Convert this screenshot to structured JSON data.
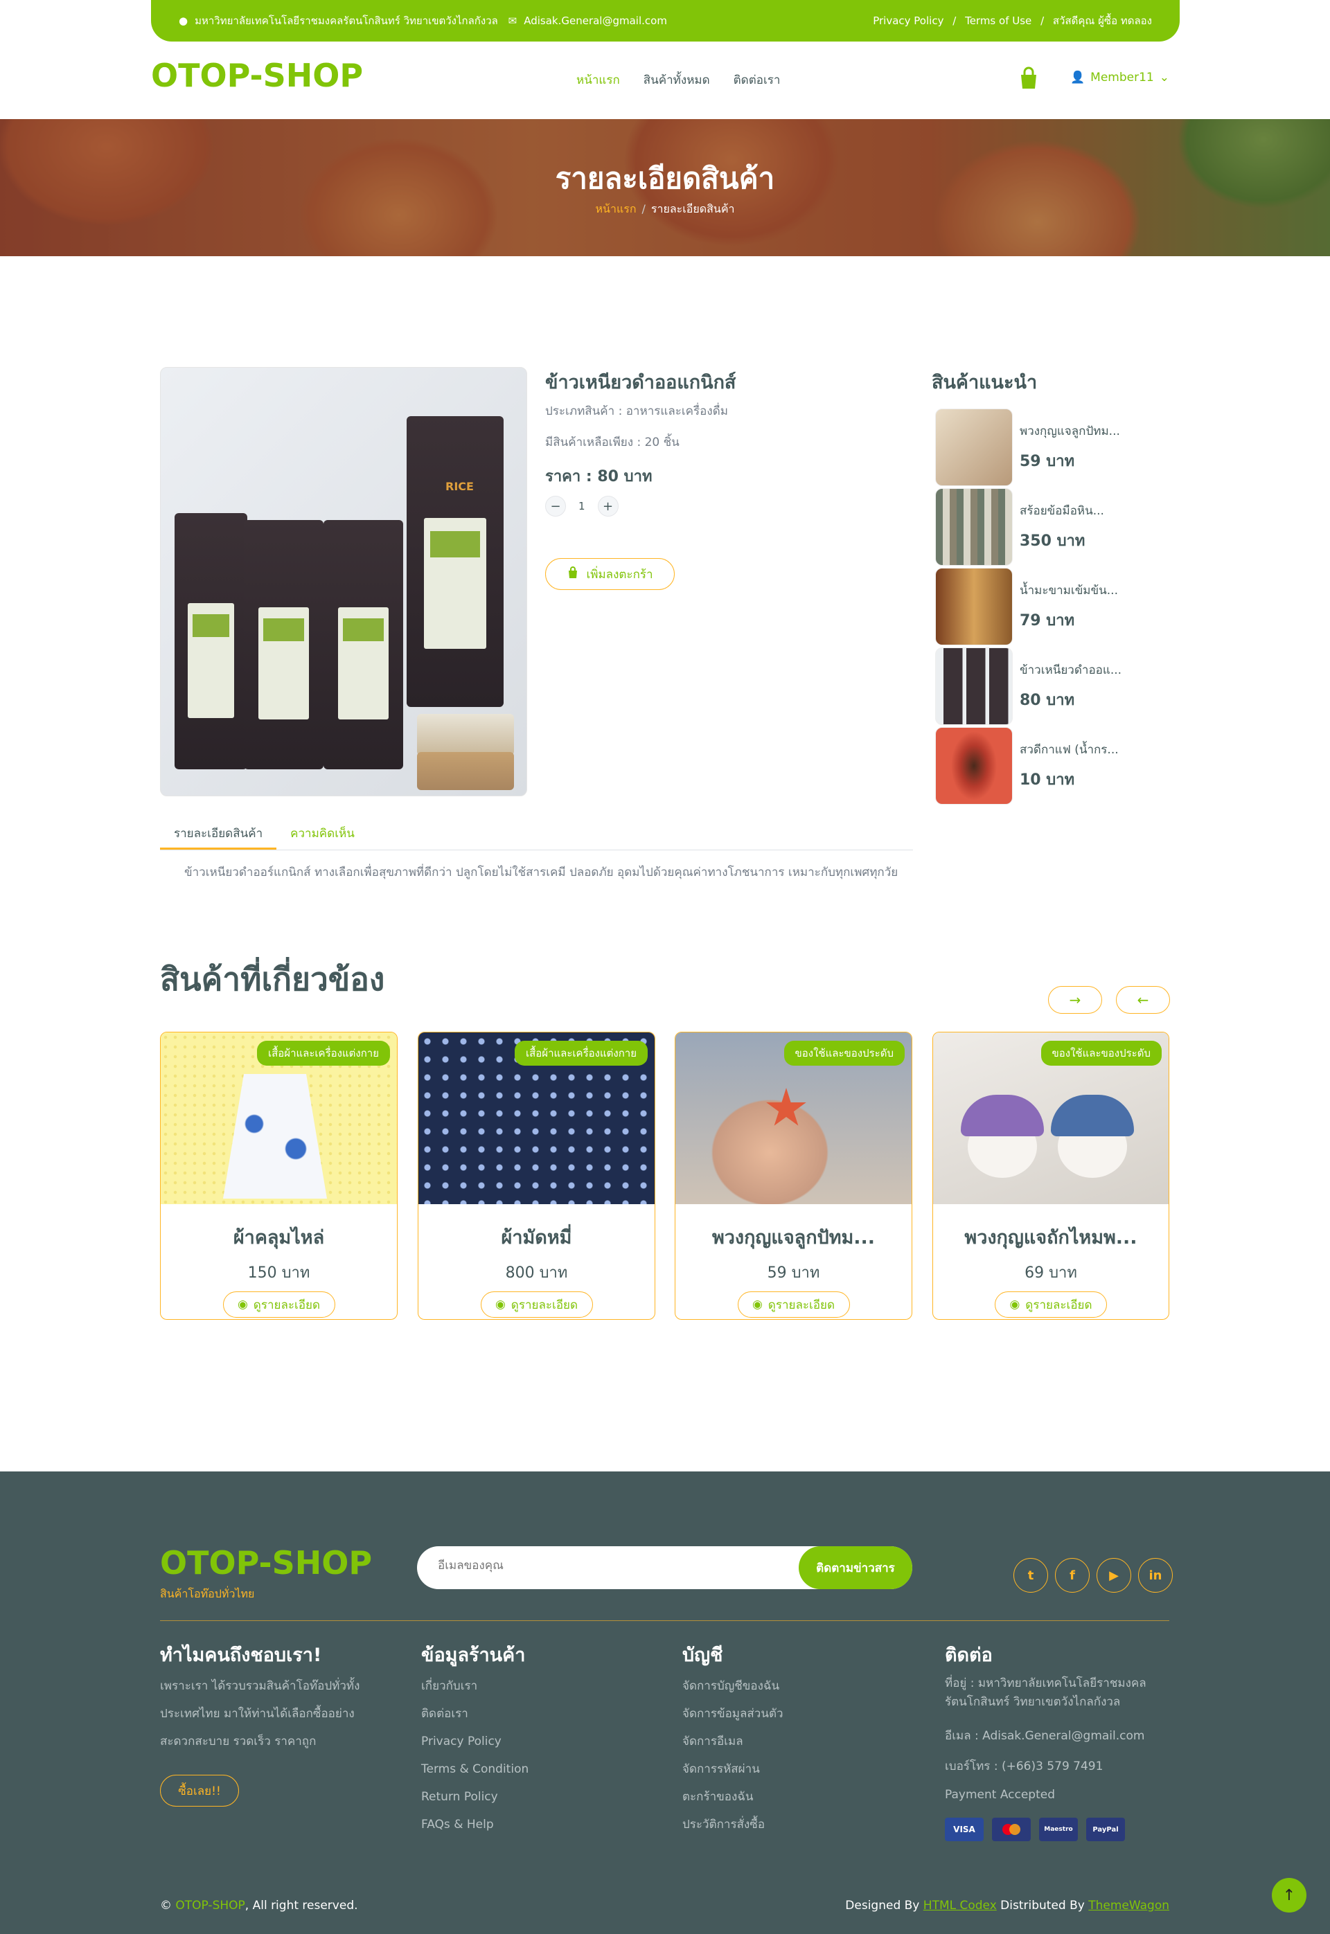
{
  "topbar": {
    "address": "มหาวิทยาลัยเทคโนโลยีราชมงคลรัตนโกสินทร์ วิทยาเขตวังไกลกังวล",
    "email": "Adisak.General@gmail.com",
    "links": [
      "Privacy Policy",
      "/",
      "Terms of Use",
      "/",
      "สวัสดีคุณ ผู้ซื้อ ทดลอง"
    ]
  },
  "nav": {
    "logo": "OTOP-SHOP",
    "items": [
      "หน้าแรก",
      "สินค้าทั้งหมด",
      "ติดต่อเรา"
    ],
    "member": "Member11"
  },
  "hero": {
    "title": "รายละเอียดสินค้า",
    "breadcrumb_home": "หน้าแรก",
    "breadcrumb_sep": "/",
    "breadcrumb_current": "รายละเอียดสินค้า"
  },
  "product": {
    "name": "ข้าวเหนียวดำออแกนิกส์",
    "category": "ประเภทสินค้า : อาหารและเครื่องดื่ม",
    "stock": "มีสินค้าเหลือเพียง : 20 ชิ้น",
    "price": "ราคา : 80 บาท",
    "qty_minus": "−",
    "qty": "1",
    "qty_plus": "+",
    "add_to_cart": "เพิ่มลงตะกร้า",
    "image_text": "RICE"
  },
  "tabs": {
    "detail": "รายละเอียดสินค้า",
    "reviews": "ความคิดเห็น",
    "description": "ข้าวเหนียวดำออร์แกนิกส์ ทางเลือกเพื่อสุขภาพที่ดีกว่า ปลูกโดยไม่ใช้สารเคมี ปลอดภัย อุดมไปด้วยคุณค่าทางโภชนาการ เหมาะกับทุกเพศทุกวัย"
  },
  "sidebar": {
    "title": "สินค้าแนะนำ",
    "items": [
      {
        "name": "พวงกุญแจลูกปัทม...",
        "price": "59 บาท",
        "color": "#d7c9b2"
      },
      {
        "name": "สร้อยข้อมือหิน...",
        "price": "350 บาท",
        "color": "#b7b9a8"
      },
      {
        "name": "น้ำมะขามเข้มข้น...",
        "price": "79 บาท",
        "color": "#c98a3a"
      },
      {
        "name": "ข้าวเหนียวดำออแ...",
        "price": "80 บาท",
        "color": "#5a5158"
      },
      {
        "name": "สวดีกาแฟ (น้ำกร...",
        "price": "10 บาท",
        "color": "#c44a3c"
      }
    ]
  },
  "related": {
    "title": "สินค้าที่เกี่ยวข้อง",
    "next": "→",
    "prev": "←",
    "view_label": "ดูรายละเอียด",
    "items": [
      {
        "badge": "เสื้อผ้าและเครื่องแต่งกาย",
        "name": "ผ้าคลุมไหล่",
        "price": "150 บาท",
        "bg": "#fbf3a0"
      },
      {
        "badge": "เสื้อผ้าและเครื่องแต่งกาย",
        "name": "ผ้ามัดหมี่",
        "price": "800 บาท",
        "bg": "#1f2d4f"
      },
      {
        "badge": "ของใช้และของประดับ",
        "name": "พวงกุญแจลูกปัทม...",
        "price": "59 บาท",
        "bg": "#c8b9a8"
      },
      {
        "badge": "ของใช้และของประดับ",
        "name": "พวงกุญแจถักไหมพ...",
        "price": "69 บาท",
        "bg": "#dcd8d2"
      }
    ]
  },
  "footer": {
    "logo": "OTOP-SHOP",
    "tagline": "สินค้าโอท๊อปทั่วไทย",
    "email_placeholder": "อีเมลของคุณ",
    "subscribe": "ติดตามข่าวสาร",
    "socials": [
      "t",
      "f",
      "▶",
      "in"
    ],
    "why_title": "ทำไมคนถึงชอบเรา!",
    "why_text": [
      "เพราะเรา ได้รวบรวมสินค้าโอท๊อปทั่วทั้ง",
      "ประเทศไทย มาให้ท่านได้เลือกซื้ออย่าง",
      "สะดวกสะบาย รวดเร็ว ราคาถูก"
    ],
    "buy_now": "ซื้อเลย!!",
    "shop_title": "ข้อมูลร้านค้า",
    "shop_links": [
      "เกี่ยวกับเรา",
      "ติดต่อเรา",
      "Privacy Policy",
      "Terms & Condition",
      "Return Policy",
      "FAQs & Help"
    ],
    "account_title": "บัญชี",
    "account_links": [
      "จัดการบัญชีของฉัน",
      "จัดการข้อมูลส่วนตัว",
      "จัดการอีเมล",
      "จัดการรหัสผ่าน",
      "ตะกร้าของฉัน",
      "ประวัติการสั่งซื้อ"
    ],
    "contact_title": "ติดต่อ",
    "address": [
      "ที่อยู่ : มหาวิทยาลัยเทคโนโลยีราชมงคล",
      "รัตนโกสินทร์ วิทยาเขตวังไกลกังวล"
    ],
    "email": "อีเมล : Adisak.General@gmail.com",
    "phone": "เบอร์โทร : (+66)3 579 7491",
    "payment_label": "Payment Accepted",
    "payments": [
      "VISA",
      "MC",
      "Maestro",
      "PayPal"
    ],
    "copyright_brand": "OTOP-SHOP",
    "copyright_text": ", All right reserved.",
    "designed_by": "Designed By ",
    "designer": "HTML Codex",
    "distributed_by": " Distributed By ",
    "distributor": "ThemeWagon",
    "back_to_top": "↑"
  },
  "colors": {
    "primary": "#81c408",
    "secondary": "#ffb524",
    "dark": "#45595b"
  }
}
